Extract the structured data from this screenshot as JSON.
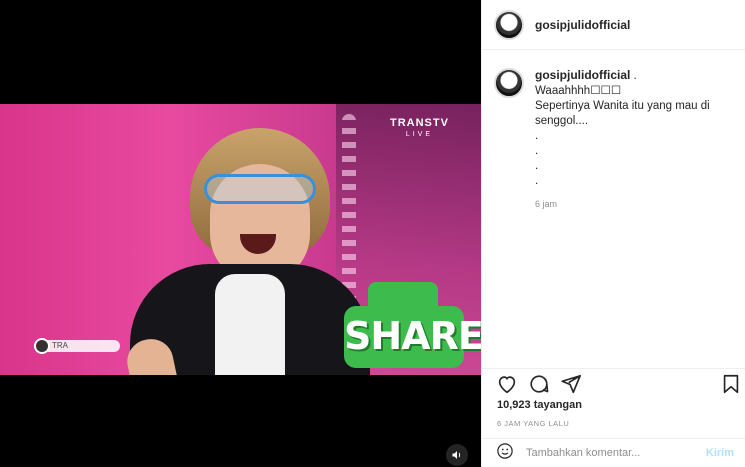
{
  "post": {
    "username": "gosipjulidofficial",
    "caption": {
      "username": "gosipjulidofficial",
      "suffix": " .",
      "lines": [
        "Waaahhhh☐☐☐",
        "Sepertinya Wanita itu yang mau di",
        "senggol....",
        ".",
        ".",
        ".",
        "."
      ],
      "time": "6 jam"
    },
    "views": "10,923 tayangan",
    "posted_ago": "6 JAM YANG LALU",
    "comment": {
      "placeholder": "Tambahkan komentar...",
      "send_label": "Kirim"
    }
  },
  "video": {
    "channel_logo": "TRANSTV",
    "channel_sub": "LIVE",
    "lower_third": "TRA",
    "sticker_text": "SHARE",
    "share_color": "#3dbb4c"
  },
  "icons": {
    "like": "heart-icon",
    "comment": "comment-icon",
    "share": "paper-plane-icon",
    "save": "bookmark-icon",
    "emoji": "emoji-icon",
    "sound": "speaker-icon"
  }
}
